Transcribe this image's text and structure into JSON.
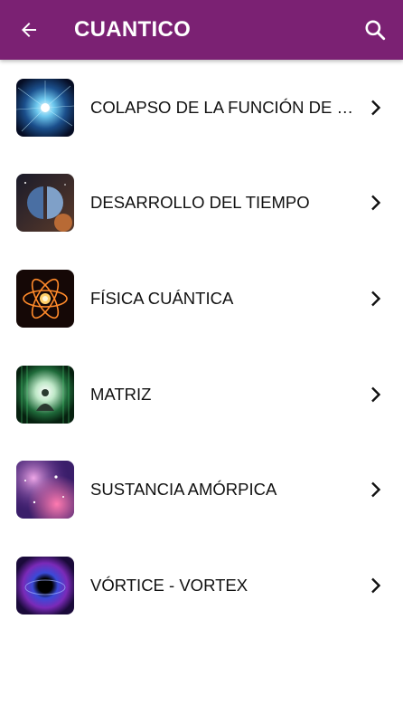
{
  "appbar": {
    "title": "CUANTICO",
    "background": "#7b2173",
    "back_icon": "arrow-left-icon",
    "search_icon": "search-icon"
  },
  "items": [
    {
      "label": "COLAPSO DE LA FUNCIÓN DE ONDA",
      "thumbnail": "particle-burst-image"
    },
    {
      "label": "DESARROLLO DEL TIEMPO",
      "thumbnail": "split-planet-image"
    },
    {
      "label": "FÍSICA CUÁNTICA",
      "thumbnail": "atom-image"
    },
    {
      "label": "MATRIZ",
      "thumbnail": "meditating-figure-matrix-image"
    },
    {
      "label": "SUSTANCIA AMÓRPICA",
      "thumbnail": "nebula-image"
    },
    {
      "label": "VÓRTICE - VORTEX",
      "thumbnail": "black-hole-vortex-image"
    }
  ]
}
